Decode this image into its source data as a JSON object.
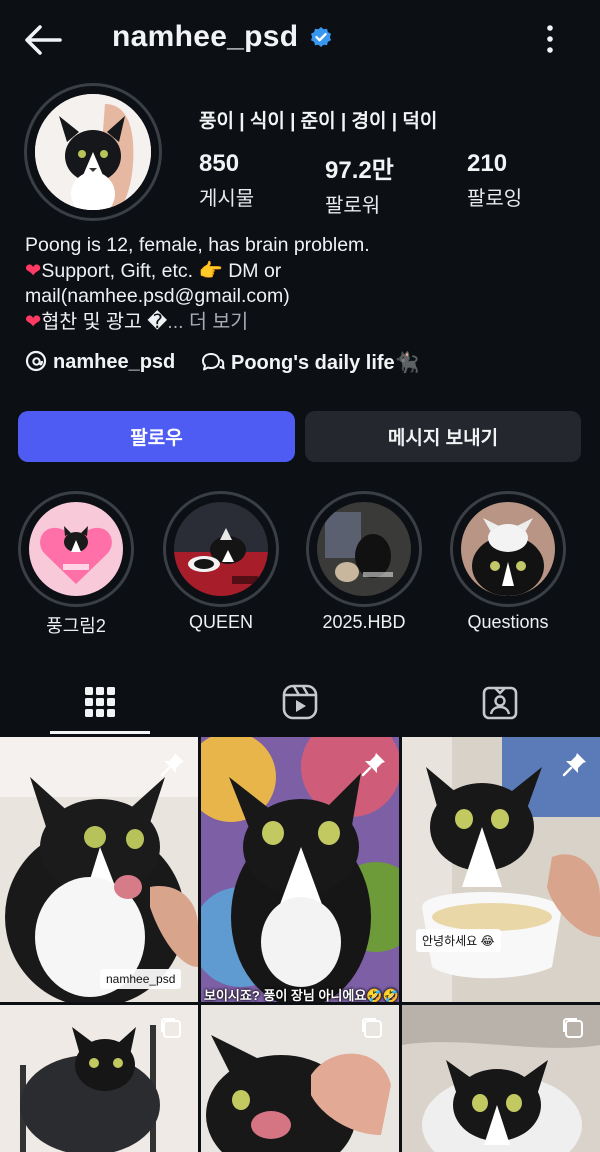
{
  "header": {
    "username": "namhee_psd"
  },
  "profile": {
    "display_names": "풍이 | 식이 | 준이 | 경이 | 덕이",
    "stats": [
      {
        "value": "850",
        "label": "게시물"
      },
      {
        "value": "97.2만",
        "label": "팔로워"
      },
      {
        "value": "210",
        "label": "팔로잉"
      }
    ],
    "bio": {
      "line1": "Poong is 12, female, has brain problem.",
      "line2_text": "Support, Gift, etc. ",
      "line2_emoji": "👉",
      "line2_tail": " DM or",
      "line3": "mail(namhee.psd@gmail.com)",
      "line4_text": "협찬 및 광고 �",
      "more": "... 더 보기"
    },
    "links": [
      {
        "label": "namhee_psd",
        "icon": "threads-icon"
      },
      {
        "label": "Poong's daily life🐈‍⬛",
        "icon": "chat-bubble-icon"
      }
    ]
  },
  "actions": {
    "follow": "팔로우",
    "message": "메시지 보내기"
  },
  "highlights": [
    {
      "label": "풍그림2"
    },
    {
      "label": "QUEEN"
    },
    {
      "label": "2025.HBD"
    },
    {
      "label": "Questions"
    }
  ],
  "tabs": [
    {
      "name": "grid-icon"
    },
    {
      "name": "reels-icon"
    },
    {
      "name": "tagged-icon"
    }
  ],
  "posts": [
    {
      "caption": "namhee_psd",
      "pinned": true
    },
    {
      "caption": "보이시죠? 풍이 장님 아니에요🤣🤣",
      "pinned": true
    },
    {
      "caption": "안녕하세요 😂",
      "pinned": true
    },
    {
      "caption": "",
      "pinned": false
    },
    {
      "caption": "",
      "pinned": false
    },
    {
      "caption": "",
      "pinned": false
    }
  ],
  "colors": {
    "background": "#0c0f14",
    "follow_button": "#4e5cf3",
    "verified": "#3897f0",
    "heart": "#ff3b64"
  }
}
